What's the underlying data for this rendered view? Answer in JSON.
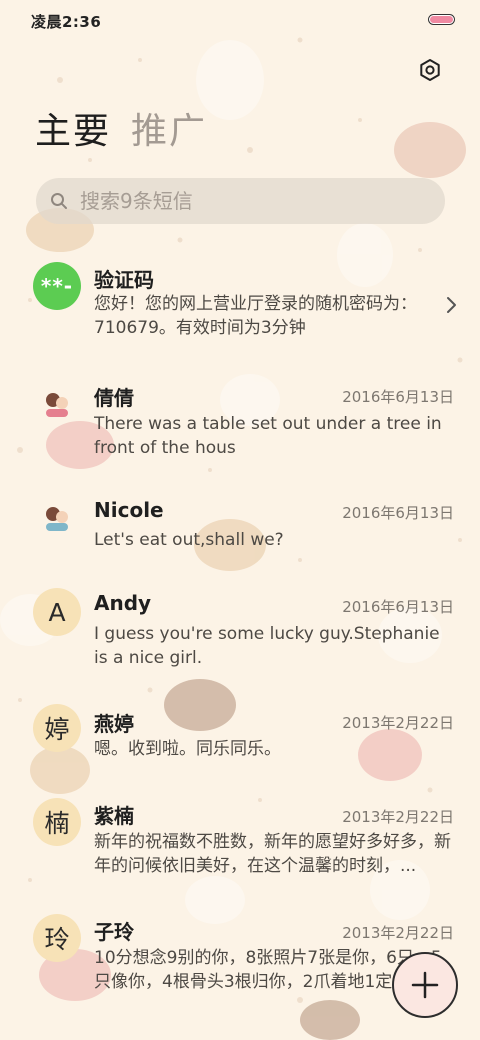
{
  "status_bar": {
    "time": "凌晨2:36"
  },
  "header": {
    "tabs": [
      {
        "label": "主要",
        "active": true
      },
      {
        "label": "推广",
        "active": false
      }
    ]
  },
  "search": {
    "placeholder": "搜索9条短信"
  },
  "threads": [
    {
      "avatar": "**-",
      "avatar_type": "verification",
      "name": "验证码",
      "date": "",
      "preview": "您好！您的网上营业厅登录的随机密码为：710679。有效时间为3分钟"
    },
    {
      "avatar": "",
      "avatar_type": "picture",
      "name": "倩倩",
      "date": "2016年6月13日",
      "preview": "There was a table set out under a tree in front of the hous"
    },
    {
      "avatar": "",
      "avatar_type": "picture",
      "name": "Nicole",
      "date": "2016年6月13日",
      "preview": "Let's eat out,shall we?"
    },
    {
      "avatar": "A",
      "avatar_type": "letter",
      "name": "Andy",
      "date": "2016年6月13日",
      "preview": "I guess you're some lucky guy.Stephanie is a nice girl."
    },
    {
      "avatar": "婷",
      "avatar_type": "letter",
      "name": "燕婷",
      "date": "2013年2月22日",
      "preview": "嗯。收到啦。同乐同乐。"
    },
    {
      "avatar": "楠",
      "avatar_type": "letter",
      "name": "紫楠",
      "date": "2013年2月22日",
      "preview": "新年的祝福数不胜数，新年的愿望好多好多，新年的问候依旧美好，在这个温馨的时刻，..."
    },
    {
      "avatar": "玲",
      "avatar_type": "letter",
      "name": "子玲",
      "date": "2013年2月22日",
      "preview": "10分想念9别的你，8张照片7张是你，6只…5只像你，4根骨头3根归你，2爪着地1定…"
    }
  ],
  "colors": {
    "background": "#fcf3e6",
    "avatar_letter_bg": "#f7e2b7",
    "avatar_code_bg": "#5ccc52",
    "fab_bg": "#fbe7e1"
  },
  "icons": {
    "settings": "settings-icon",
    "search": "search-icon",
    "compose": "plus-icon",
    "chevron": "chevron-right-icon"
  }
}
